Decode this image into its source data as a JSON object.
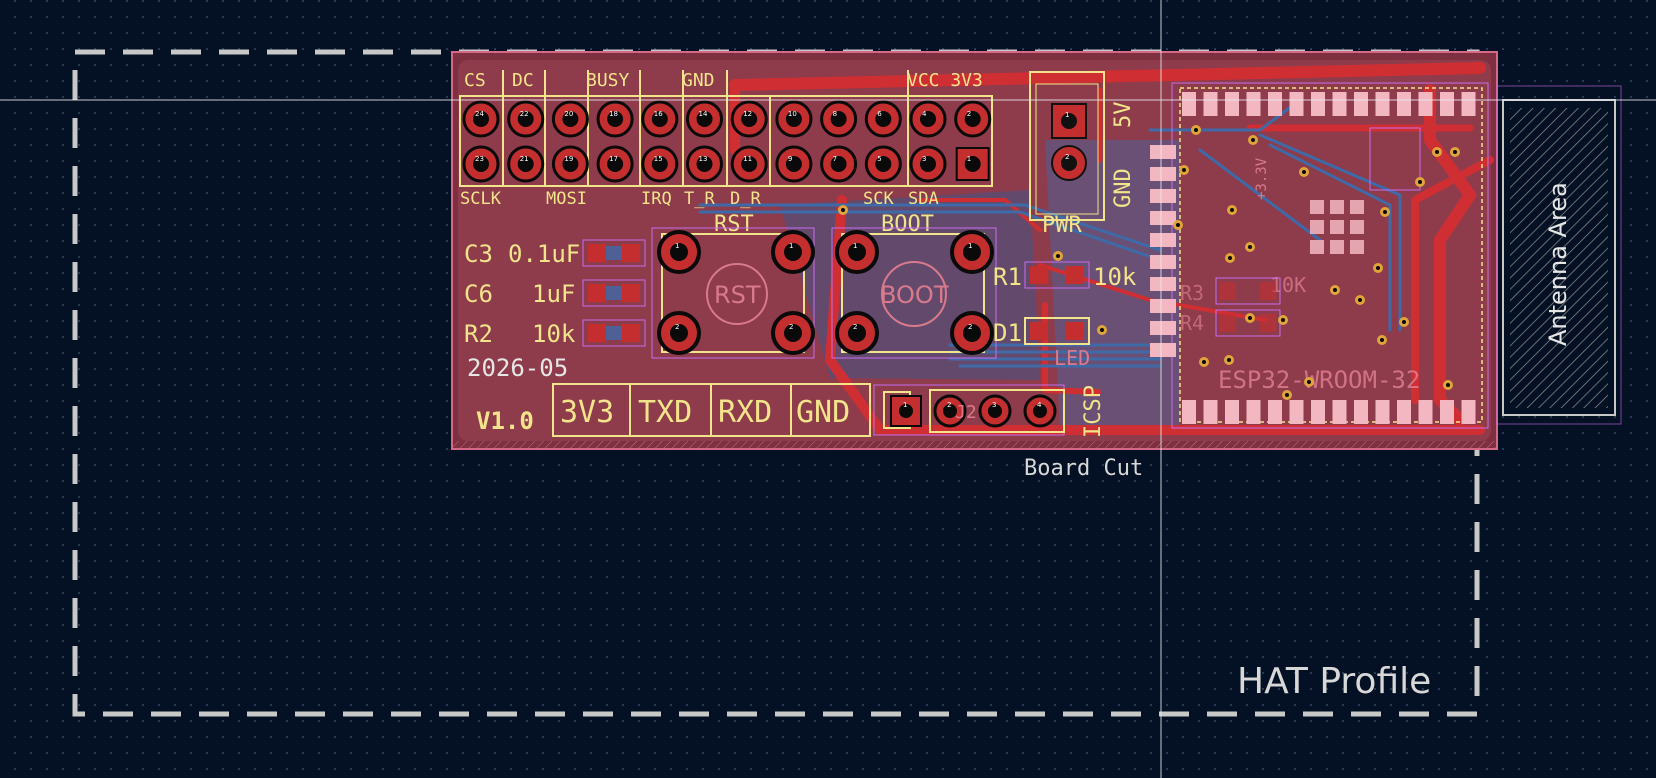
{
  "viewer": {
    "app": "PCB Editor",
    "crosshair": true
  },
  "labels": {
    "hat_profile": "HAT Profile",
    "board_cut": "Board Cut",
    "antenna_area": "Antenna Area",
    "esp32": "ESP32-WROOM-32",
    "rst": "RST",
    "boot": "BOOT",
    "pwr": "PWR",
    "icsp": "ICSP",
    "version": "V1.0",
    "date": "2026-05",
    "five_v": "5V",
    "gnd_vertical": "GND",
    "j2": "J2"
  },
  "header_top_labels": [
    "CS",
    "DC",
    "BUSY",
    "GND",
    "VCC 3V3"
  ],
  "header_bottom_labels": [
    "SCLK",
    "MOSI",
    "IRQ",
    "T_R",
    "D_R",
    "SCK",
    "SDA"
  ],
  "pins_top": [
    "24",
    "22",
    "20",
    "18",
    "16",
    "14",
    "12",
    "10",
    "8",
    "6",
    "4",
    "2"
  ],
  "pins_bottom": [
    "23",
    "21",
    "19",
    "17",
    "15",
    "13",
    "11",
    "9",
    "7",
    "5",
    "3",
    "1"
  ],
  "components": [
    {
      "ref": "C3",
      "value": "0.1uF"
    },
    {
      "ref": "C6",
      "value": "1uF"
    },
    {
      "ref": "R2",
      "value": "10k"
    }
  ],
  "r1": {
    "ref": "R1",
    "value": "10k"
  },
  "d1": {
    "ref": "D1",
    "value": "LED"
  },
  "serial_header": [
    "3V3",
    "TXD",
    "RXD",
    "GND"
  ],
  "icsp_pins": [
    "1",
    "2",
    "3",
    "4"
  ],
  "pwr_pins": [
    "1",
    "2"
  ],
  "button_pins": [
    "1",
    "2"
  ],
  "silk_misc": [
    "+3.3V",
    "10K",
    "R3",
    "R4"
  ],
  "colors": {
    "background": "#041124",
    "grid_dot": "#2a3b55",
    "profile_outline": "#c8c8c8",
    "board_fill": "#8e3b4b",
    "copper_front": "#cf2f33",
    "copper_back": "#3f6aa8",
    "silkscreen": "#f2e48a",
    "pad": "#c42e2e",
    "pad_light": "#f3b7c2",
    "courtyard": "#c86cf0"
  }
}
